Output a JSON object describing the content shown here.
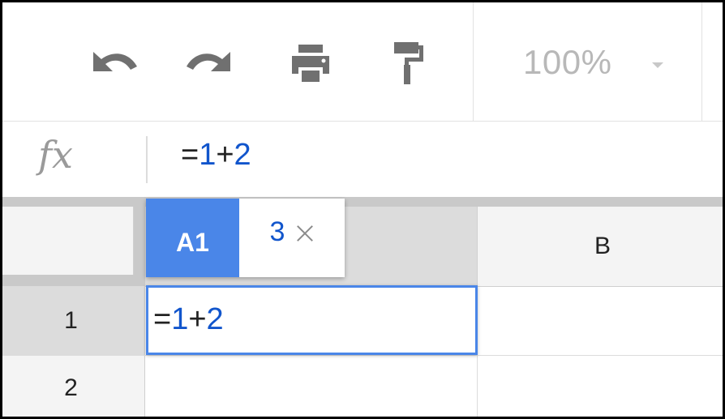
{
  "toolbar": {
    "undo_icon": "undo-icon",
    "redo_icon": "redo-icon",
    "print_icon": "print-icon",
    "paint_format_icon": "paint-format-icon",
    "zoom_value": "100%",
    "zoom_caret_icon": "chevron-down-icon"
  },
  "formula_bar": {
    "fx_label": "fx",
    "formula": {
      "eq": "=",
      "operand1": "1",
      "operator": "+",
      "operand2": "2"
    }
  },
  "grid": {
    "columns": [
      "",
      "B"
    ],
    "rows": [
      "1",
      "2"
    ],
    "active_cell": {
      "eq": "=",
      "operand1": "1",
      "operator": "+",
      "operand2": "2"
    }
  },
  "tooltip": {
    "cell_ref": "A1",
    "result": "3",
    "close_icon": "close-icon"
  },
  "colors": {
    "accent": "#4a86e8",
    "formula_number": "#1155cc",
    "icon_gray": "#707070"
  }
}
